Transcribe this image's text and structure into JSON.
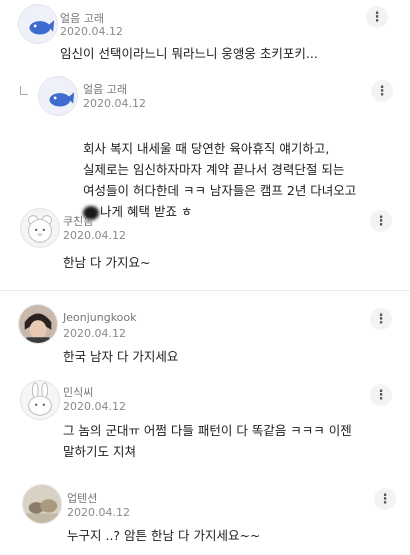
{
  "comments": [
    {
      "author": "얼음 고래",
      "date": "2020.04.12",
      "text": "임신이 선택이라느니 뭐라느니 웅앵웅 초키포키...",
      "avatar": "whale-avatar"
    },
    {
      "author": "얼음 고래",
      "date": "2020.04.12",
      "text_a": "회사 복지 내세울 때 당연한 육아휴직 얘기하고,\n실제로는 임신하자마자 계약 끝나서 경력단절 되는\n여성들이 허다한데 ㅋㅋ 남자들은 캠프 2년 다녀오고",
      "text_b": "나게 혜택 받죠 ㅎ",
      "avatar": "whale-avatar",
      "is_reply": true
    },
    {
      "author": "쿠친놈",
      "date": "2020.04.12",
      "text": "한남 다 가지요~",
      "avatar": "bear-avatar"
    },
    {
      "author": "Jeonjungkook",
      "date": "2020.04.12",
      "text": "한국 남자 다 가지세요",
      "avatar": "person-avatar"
    },
    {
      "author": "민식씨",
      "date": "2020.04.12",
      "text": "그 놈의 군대ㅠ 어쩜 다들 패턴이 다 똑같음 ㅋㅋㅋ 이젠\n말하기도 지쳐",
      "avatar": "rabbit-avatar"
    },
    {
      "author": "업텐션",
      "date": "2020.04.12",
      "text": "누구지 ..? 암튼 한남 다 가지세요~~",
      "avatar": "photo-avatar"
    }
  ],
  "more_icon": "⋮"
}
